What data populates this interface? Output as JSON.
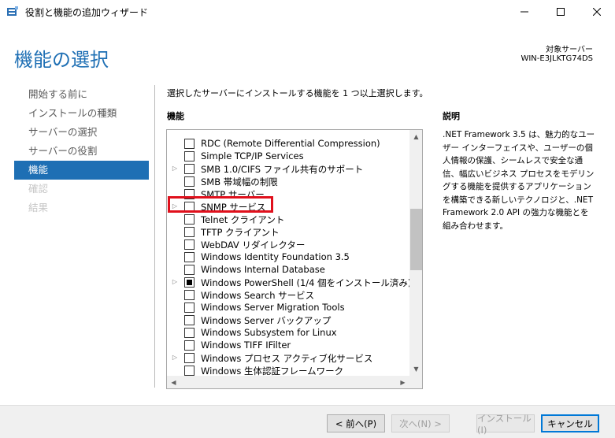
{
  "window": {
    "title": "役割と機能の追加ウィザード",
    "min_icon": "minimize-icon",
    "max_icon": "maximize-icon",
    "close_icon": "close-icon"
  },
  "header": {
    "page_title": "機能の選択",
    "target_label": "対象サーバー",
    "target_name": "WIN-E3JLKTG74DS"
  },
  "nav": {
    "items": [
      {
        "label": "開始する前に",
        "state": "normal"
      },
      {
        "label": "インストールの種類",
        "state": "normal"
      },
      {
        "label": "サーバーの選択",
        "state": "normal"
      },
      {
        "label": "サーバーの役割",
        "state": "normal"
      },
      {
        "label": "機能",
        "state": "active"
      },
      {
        "label": "確認",
        "state": "disabled"
      },
      {
        "label": "結果",
        "state": "disabled"
      }
    ]
  },
  "main": {
    "instruction": "選択したサーバーにインストールする機能を 1 つ以上選択します。",
    "features_heading": "機能",
    "description_heading": "説明",
    "description": ".NET Framework 3.5 は、魅力的なユーザー インターフェイスや、ユーザーの個人情報の保護、シームレスで安全な通信、幅広いビジネス プロセスをモデリングする機能を提供するアプリケーションを構築できる新しいテクノロジと、.NET Framework 2.0 API の強力な機能とを組み合わせます。"
  },
  "features": [
    {
      "label": "RDC (Remote Differential Compression)",
      "expandable": false,
      "state": "unchecked"
    },
    {
      "label": "Simple TCP/IP Services",
      "expandable": false,
      "state": "unchecked"
    },
    {
      "label": "SMB 1.0/CIFS ファイル共有のサポート",
      "expandable": true,
      "state": "unchecked"
    },
    {
      "label": "SMB 帯域幅の制限",
      "expandable": false,
      "state": "unchecked"
    },
    {
      "label": "SMTP サーバー",
      "expandable": false,
      "state": "unchecked"
    },
    {
      "label": "SNMP サービス",
      "expandable": true,
      "state": "unchecked"
    },
    {
      "label": "Telnet クライアント",
      "expandable": false,
      "state": "unchecked"
    },
    {
      "label": "TFTP クライアント",
      "expandable": false,
      "state": "unchecked"
    },
    {
      "label": "WebDAV リダイレクター",
      "expandable": false,
      "state": "unchecked"
    },
    {
      "label": "Windows Identity Foundation 3.5",
      "expandable": false,
      "state": "unchecked"
    },
    {
      "label": "Windows Internal Database",
      "expandable": false,
      "state": "unchecked"
    },
    {
      "label": "Windows PowerShell (1/4 個をインストール済み)",
      "expandable": true,
      "state": "partial"
    },
    {
      "label": "Windows Search サービス",
      "expandable": false,
      "state": "unchecked"
    },
    {
      "label": "Windows Server Migration Tools",
      "expandable": false,
      "state": "unchecked"
    },
    {
      "label": "Windows Server バックアップ",
      "expandable": false,
      "state": "unchecked"
    },
    {
      "label": "Windows Subsystem for Linux",
      "expandable": false,
      "state": "unchecked"
    },
    {
      "label": "Windows TIFF IFilter",
      "expandable": false,
      "state": "unchecked"
    },
    {
      "label": "Windows プロセス アクティブ化サービス",
      "expandable": true,
      "state": "unchecked"
    },
    {
      "label": "Windows 生体認証フレームワーク",
      "expandable": false,
      "state": "unchecked"
    }
  ],
  "footer": {
    "prev": "< 前へ(P)",
    "next": "次へ(N) >",
    "install": "インストール(I)",
    "cancel": "キャンセル"
  }
}
